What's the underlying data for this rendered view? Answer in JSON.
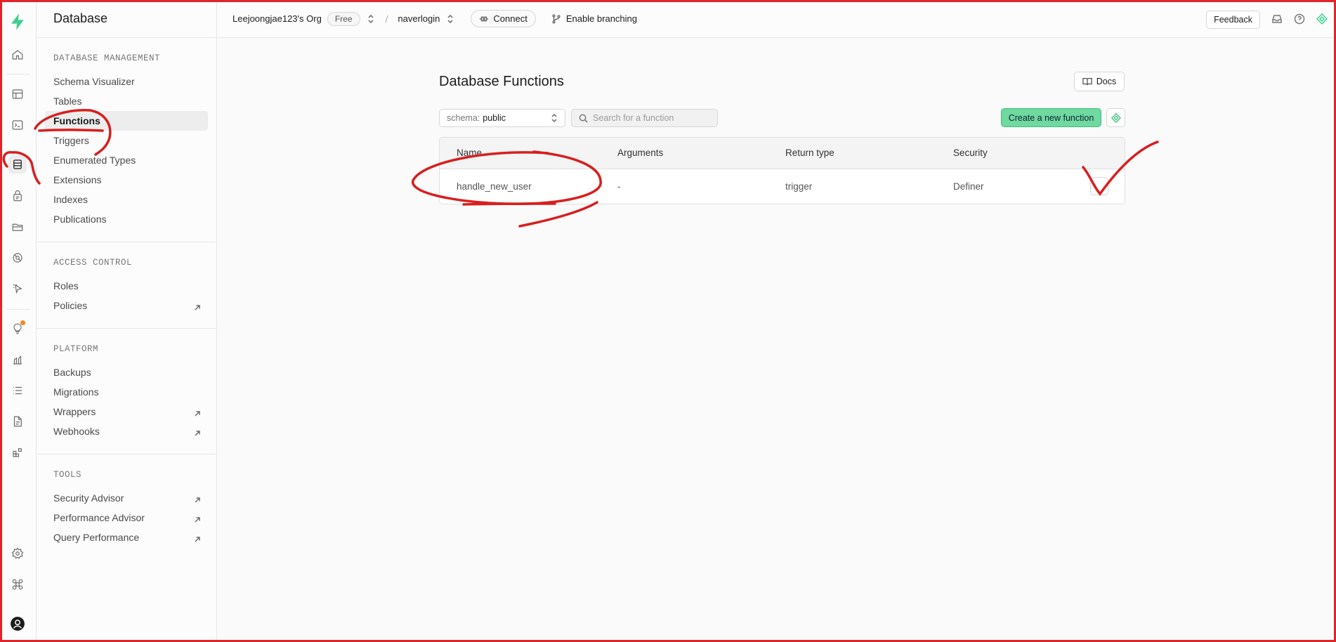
{
  "app": {
    "section_title": "Database"
  },
  "topbar": {
    "org": "Leejoongjae123's Org",
    "plan": "Free",
    "project": "naverlogin",
    "connect": "Connect",
    "branching": "Enable branching",
    "feedback": "Feedback"
  },
  "sidebar": {
    "sections": [
      {
        "title": "DATABASE MANAGEMENT",
        "items": [
          "Schema Visualizer",
          "Tables",
          "Functions",
          "Triggers",
          "Enumerated Types",
          "Extensions",
          "Indexes",
          "Publications"
        ]
      },
      {
        "title": "ACCESS CONTROL",
        "items": [
          "Roles",
          "Policies"
        ]
      },
      {
        "title": "PLATFORM",
        "items": [
          "Backups",
          "Migrations",
          "Wrappers",
          "Webhooks"
        ]
      },
      {
        "title": "TOOLS",
        "items": [
          "Security Advisor",
          "Performance Advisor",
          "Query Performance"
        ]
      }
    ],
    "active_item": "Functions"
  },
  "main": {
    "title": "Database Functions",
    "docs": "Docs",
    "schema_label": "schema:",
    "schema_value": "public",
    "search_placeholder": "Search for a function",
    "create_button": "Create a new function",
    "table": {
      "columns": [
        "Name",
        "Arguments",
        "Return type",
        "Security"
      ],
      "rows": [
        {
          "name": "handle_new_user",
          "arguments": "-",
          "return_type": "trigger",
          "security": "Definer"
        }
      ]
    }
  },
  "colors": {
    "brand": "#3ecf8e",
    "annotation": "#d81f1f"
  }
}
